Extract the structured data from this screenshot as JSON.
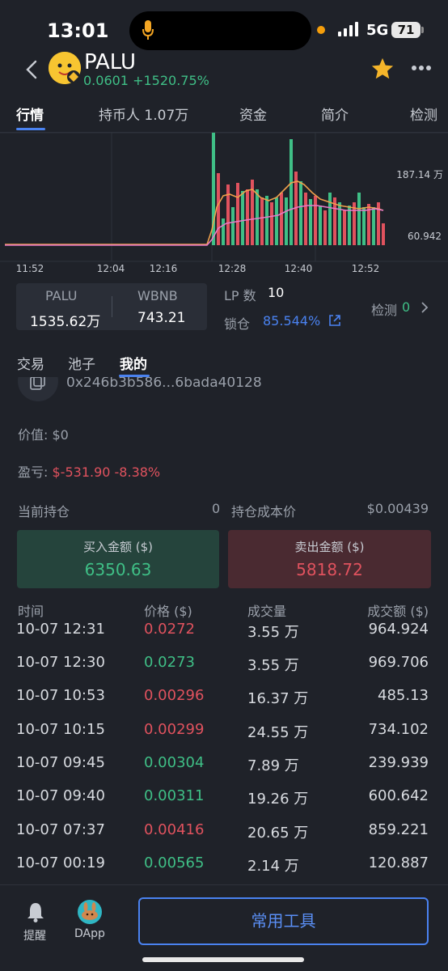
{
  "status": {
    "time": "13:01",
    "network": "5G",
    "battery": "71"
  },
  "header": {
    "token": "PALU",
    "price": "0.0601",
    "change": "+1520.75%"
  },
  "tabs": [
    "行情",
    "持币人 1.07万",
    "资金",
    "简介",
    "检测"
  ],
  "chart_data": {
    "type": "bar",
    "x_ticks": [
      "11:52",
      "12:04",
      "12:16",
      "12:28",
      "12:40",
      "12:52"
    ],
    "y_labels": [
      "187.14 万",
      "60.942"
    ],
    "colors": {
      "up": "#3fbf86",
      "down": "#e0525e",
      "ma_fast": "#f0a04b",
      "ma_slow": "#e879c9"
    }
  },
  "pool": {
    "token_a": "PALU",
    "amount_a": "1535.62万",
    "token_b": "WBNB",
    "amount_b": "743.21",
    "lp_label": "LP 数",
    "lp_count": "10",
    "lock_label": "锁仓",
    "lock_pct": "85.544%",
    "check_label": "检测",
    "check_count": "0"
  },
  "subtabs": [
    "交易",
    "池子",
    "我的"
  ],
  "wallet": {
    "address": "0x246b3b586...6bada40128"
  },
  "mine": {
    "value_label": "价值:",
    "value": "$0",
    "pnl_label": "盈亏:",
    "pnl": "$-531.90 -8.38%",
    "holding_label": "当前持仓",
    "holding": "0",
    "cost_label": "持仓成本价",
    "cost": "$0.00439",
    "buy_label": "买入金额 ($)",
    "buy_amount": "6350.63",
    "sell_label": "卖出金额 ($)",
    "sell_amount": "5818.72"
  },
  "table": {
    "headers": [
      "时间",
      "价格 ($)",
      "成交量",
      "成交额 ($)"
    ],
    "rows": [
      {
        "time": "10-07 12:31",
        "price": "0.0272",
        "vol": "3.55 万",
        "amount": "964.924",
        "dir": "down"
      },
      {
        "time": "10-07 12:30",
        "price": "0.0273",
        "vol": "3.55 万",
        "amount": "969.706",
        "dir": "up"
      },
      {
        "time": "10-07 10:53",
        "price": "0.00296",
        "vol": "16.37 万",
        "amount": "485.13",
        "dir": "down"
      },
      {
        "time": "10-07 10:15",
        "price": "0.00299",
        "vol": "24.55 万",
        "amount": "734.102",
        "dir": "down"
      },
      {
        "time": "10-07 09:45",
        "price": "0.00304",
        "vol": "7.89 万",
        "amount": "239.939",
        "dir": "up"
      },
      {
        "time": "10-07 09:40",
        "price": "0.00311",
        "vol": "19.26 万",
        "amount": "600.642",
        "dir": "up"
      },
      {
        "time": "10-07 07:37",
        "price": "0.00416",
        "vol": "20.65 万",
        "amount": "859.221",
        "dir": "down"
      },
      {
        "time": "10-07 00:19",
        "price": "0.00565",
        "vol": "2.14 万",
        "amount": "120.887",
        "dir": "up"
      }
    ]
  },
  "bottom": {
    "alert": "提醒",
    "dapp": "DApp",
    "tools": "常用工具"
  }
}
